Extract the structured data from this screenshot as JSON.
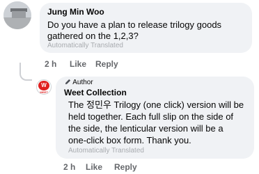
{
  "comment": {
    "author": "Jung Min Woo",
    "lines": [
      "Do you have a plan to release trilogy goods",
      "gathered on the 1,2,3?"
    ],
    "translated_note": "Automatically Translated",
    "time": "2 h",
    "like_label": "Like",
    "reply_label": "Reply"
  },
  "reply": {
    "badge_label": "Author",
    "author": "Weet Collection",
    "avatar_text": "W",
    "avatar_sub": "WEET",
    "lines": [
      "The 정민우 Trilogy (one click) version will be",
      "held together. Each full slip on the side of",
      "the side, the lenticular version will be a",
      "one-click box form. Thank you."
    ],
    "translated_note": "Automatically Translated",
    "time": "2 h",
    "like_label": "Like",
    "reply_label": "Reply"
  }
}
